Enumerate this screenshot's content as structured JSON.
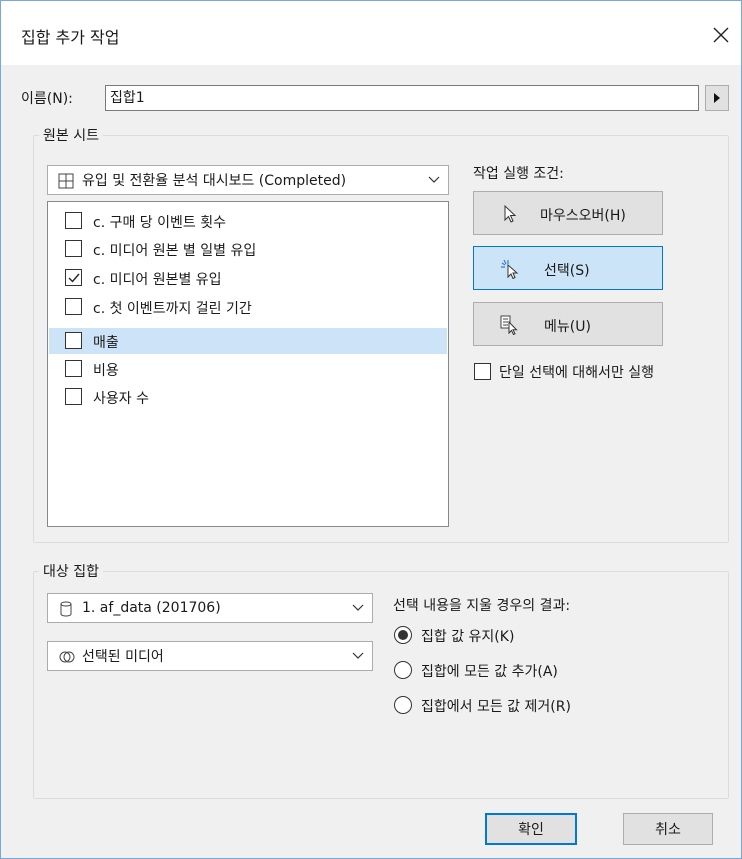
{
  "window": {
    "title": "집합 추가 작업"
  },
  "name_field": {
    "label": "이름(N):",
    "value": "집합1"
  },
  "source_sheet": {
    "group_label": "원본 시트",
    "dropdown": {
      "icon": "dashboard-grid-icon",
      "value": "유입 및 전환율 분석 대시보드 (Completed)"
    },
    "items": [
      {
        "label": "c. 구매 당 이벤트 횟수",
        "checked": false,
        "highlighted": false
      },
      {
        "label": "c. 미디어 원본 별 일별 유입",
        "checked": false,
        "highlighted": false
      },
      {
        "label": "c. 미디어 원본별 유입",
        "checked": true,
        "highlighted": false
      },
      {
        "label": "c. 첫 이벤트까지 걸린 기간",
        "checked": false,
        "highlighted": false
      },
      {
        "label": "매출",
        "checked": false,
        "highlighted": true
      },
      {
        "label": "비용",
        "checked": false,
        "highlighted": false
      },
      {
        "label": "사용자 수",
        "checked": false,
        "highlighted": false
      }
    ]
  },
  "run_condition": {
    "label": "작업 실행 조건:",
    "buttons": [
      {
        "label": "마우스오버(H)",
        "icon": "hover-cursor-icon",
        "selected": false
      },
      {
        "label": "선택(S)",
        "icon": "select-click-icon",
        "selected": true
      },
      {
        "label": "메뉴(U)",
        "icon": "menu-cursor-icon",
        "selected": false
      }
    ],
    "single_select_only": {
      "label": "단일 선택에 대해서만 실행",
      "checked": false
    }
  },
  "target_set": {
    "group_label": "대상 집합",
    "datasource": {
      "icon": "database-icon",
      "value": "1. af_data (201706)"
    },
    "set": {
      "icon": "set-icon",
      "value": "선택된 미디어"
    },
    "clear_result": {
      "label": "선택 내용을 지울 경우의 결과:",
      "options": [
        {
          "label": "집합 값 유지(K)",
          "selected": true
        },
        {
          "label": "집합에 모든 값 추가(A)",
          "selected": false
        },
        {
          "label": "집합에서 모든 값 제거(R)",
          "selected": false
        }
      ]
    }
  },
  "footer": {
    "ok": "확인",
    "cancel": "취소"
  }
}
